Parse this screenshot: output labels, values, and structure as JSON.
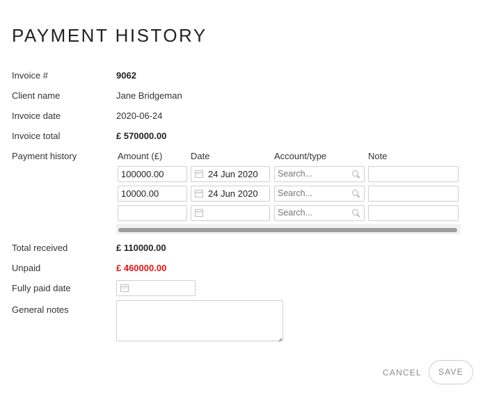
{
  "title": "PAYMENT HISTORY",
  "fields": {
    "invoice_no_label": "Invoice #",
    "invoice_no_value": "9062",
    "client_label": "Client name",
    "client_value": "Jane Bridgeman",
    "invoice_date_label": "Invoice date",
    "invoice_date_value": "2020-06-24",
    "invoice_total_label": "Invoice total",
    "invoice_total_value": "£ 570000.00",
    "payment_history_label": "Payment history",
    "total_received_label": "Total received",
    "total_received_value": "£ 110000.00",
    "unpaid_label": "Unpaid",
    "unpaid_value": "£ 460000.00",
    "fully_paid_label": "Fully paid date",
    "general_notes_label": "General notes"
  },
  "payments": {
    "columns": [
      "Amount (£)",
      "Date",
      "Account/type",
      "Note"
    ],
    "rows": [
      {
        "amount": "100000.00",
        "date": "24 Jun 2020",
        "account_placeholder": "Search...",
        "note": ""
      },
      {
        "amount": "10000.00",
        "date": "24 Jun 2020",
        "account_placeholder": "Search...",
        "note": ""
      },
      {
        "amount": "",
        "date": "",
        "account_placeholder": "Search...",
        "note": ""
      }
    ]
  },
  "actions": {
    "cancel_label": "CANCEL",
    "save_label": "SAVE"
  },
  "colors": {
    "unpaid": "#e81414",
    "border": "#cfcfcf"
  },
  "icons": {
    "date": "calendar-icon",
    "account": "search-icon"
  }
}
